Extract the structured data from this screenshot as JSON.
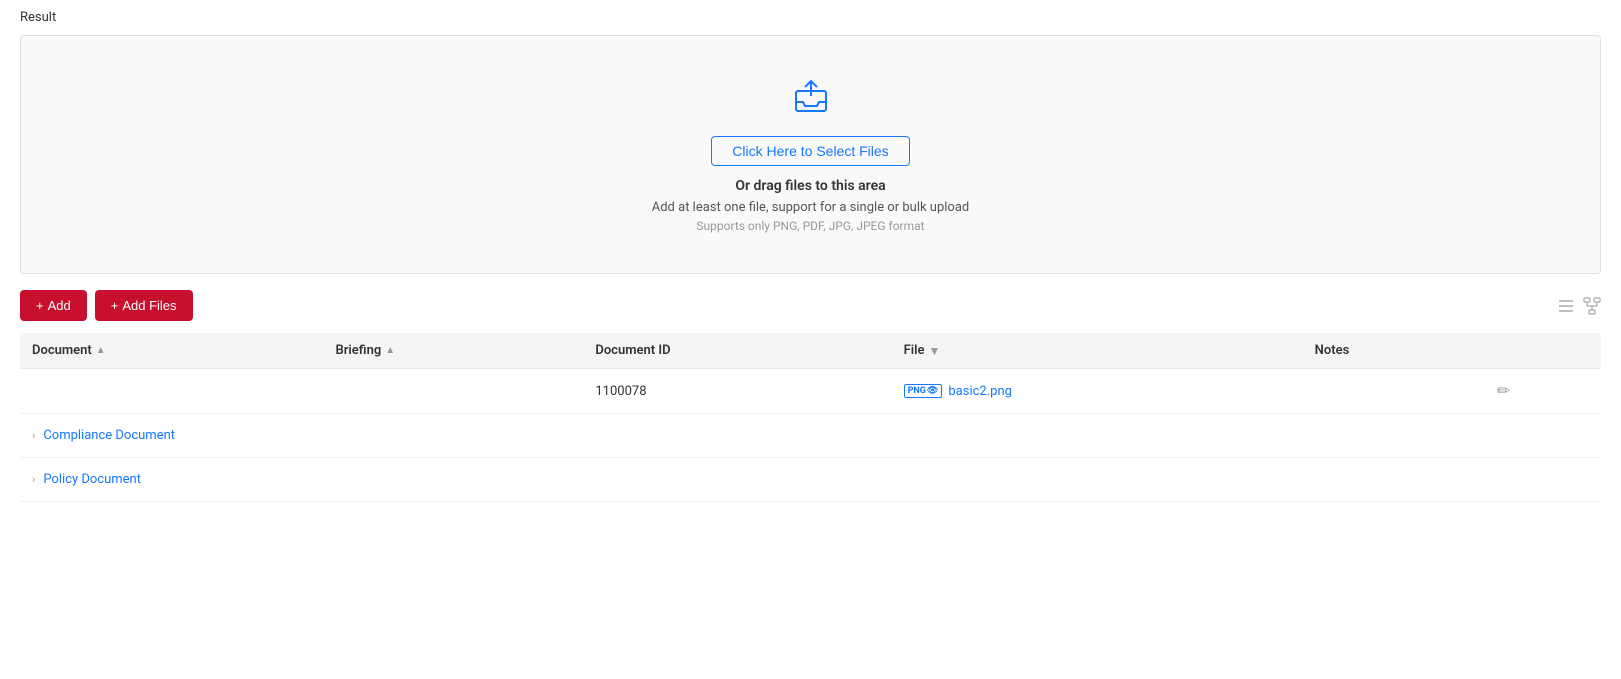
{
  "page": {
    "result_label": "Result"
  },
  "upload_zone": {
    "select_files_label": "Click Here to Select Files",
    "drag_text": "Or drag files to this area",
    "support_text": "Add at least one file, support for a single or bulk upload",
    "format_text": "Supports only PNG, PDF, JPG, JPEG format"
  },
  "toolbar": {
    "add_label": "Add",
    "add_files_label": "Add Files"
  },
  "table": {
    "columns": [
      {
        "key": "document",
        "label": "Document",
        "sort": true
      },
      {
        "key": "briefing",
        "label": "Briefing",
        "sort": true
      },
      {
        "key": "document_id",
        "label": "Document ID",
        "sort": false
      },
      {
        "key": "file",
        "label": "File",
        "filter": true
      },
      {
        "key": "notes",
        "label": "Notes",
        "sort": false
      }
    ],
    "rows": [
      {
        "document": "",
        "briefing": "",
        "document_id": "1100078",
        "file_badge": "PNG",
        "file_name": "basic2.png",
        "notes": ""
      }
    ],
    "tree_items": [
      {
        "label": "Compliance Document"
      },
      {
        "label": "Policy Document"
      }
    ]
  }
}
